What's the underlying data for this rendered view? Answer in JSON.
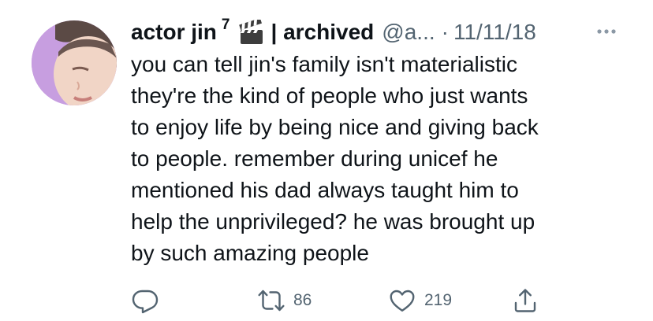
{
  "tweet": {
    "display_name": "actor jin",
    "superscript": "7",
    "name_suffix": "| archived",
    "handle": "@a...",
    "separator": "·",
    "date": "11/11/18",
    "icons": {
      "clapper": "clapper-board-icon",
      "more": "more-icon"
    },
    "text_lines": [
      "you can tell jin's family isn't materialistic",
      "they're the kind of people who just wants",
      "to enjoy life by being nice and giving back",
      "to people. remember during unicef he",
      "mentioned his dad always taught him to",
      "help the unprivileged? he was brought up",
      "by such amazing people"
    ],
    "actions": {
      "reply_icon": "reply-icon",
      "retweet_icon": "retweet-icon",
      "retweet_count": "86",
      "like_icon": "heart-icon",
      "like_count": "219",
      "share_icon": "share-icon"
    },
    "colors": {
      "text": "#0f1419",
      "secondary": "#536471",
      "background": "#ffffff",
      "avatar_bg": "#c79ee0"
    }
  }
}
